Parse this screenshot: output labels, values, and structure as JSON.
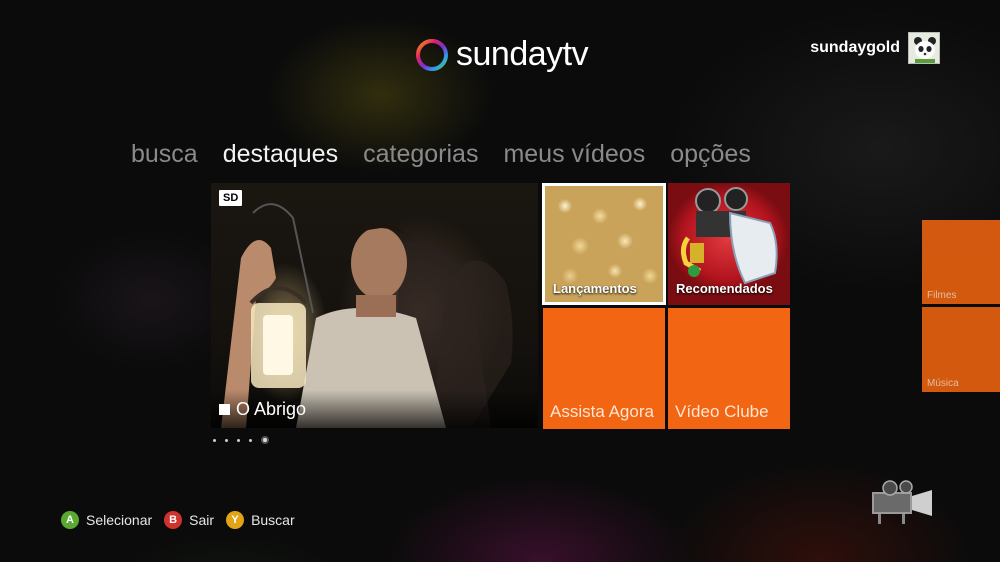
{
  "app": {
    "title": "sundaytv"
  },
  "user": {
    "name": "sundaygold",
    "avatar_icon": "panda-avatar-icon"
  },
  "nav": {
    "items": [
      {
        "label": "busca",
        "active": false
      },
      {
        "label": "destaques",
        "active": true
      },
      {
        "label": "categorias",
        "active": false
      },
      {
        "label": "meus vídeos",
        "active": false
      },
      {
        "label": "opções",
        "active": false
      }
    ]
  },
  "featured": {
    "badge": "SD",
    "title": "O Abrigo",
    "carousel": {
      "count": 5,
      "active_index": 4
    }
  },
  "tiles": {
    "lancamentos": "Lançamentos",
    "recomendados": "Recomendados",
    "assista_agora": "Assista Agora",
    "video_clube": "Vídeo Clube"
  },
  "side_tiles": {
    "filmes": "Filmes",
    "musica": "Música"
  },
  "hints": [
    {
      "button": "A",
      "label": "Selecionar",
      "color": "#5aa832"
    },
    {
      "button": "B",
      "label": "Sair",
      "color": "#d0322d"
    },
    {
      "button": "Y",
      "label": "Buscar",
      "color": "#e0a416"
    }
  ],
  "colors": {
    "accent": "#f26512",
    "tile_selected_border": "#ffffff",
    "background": "#0b0b0b"
  }
}
